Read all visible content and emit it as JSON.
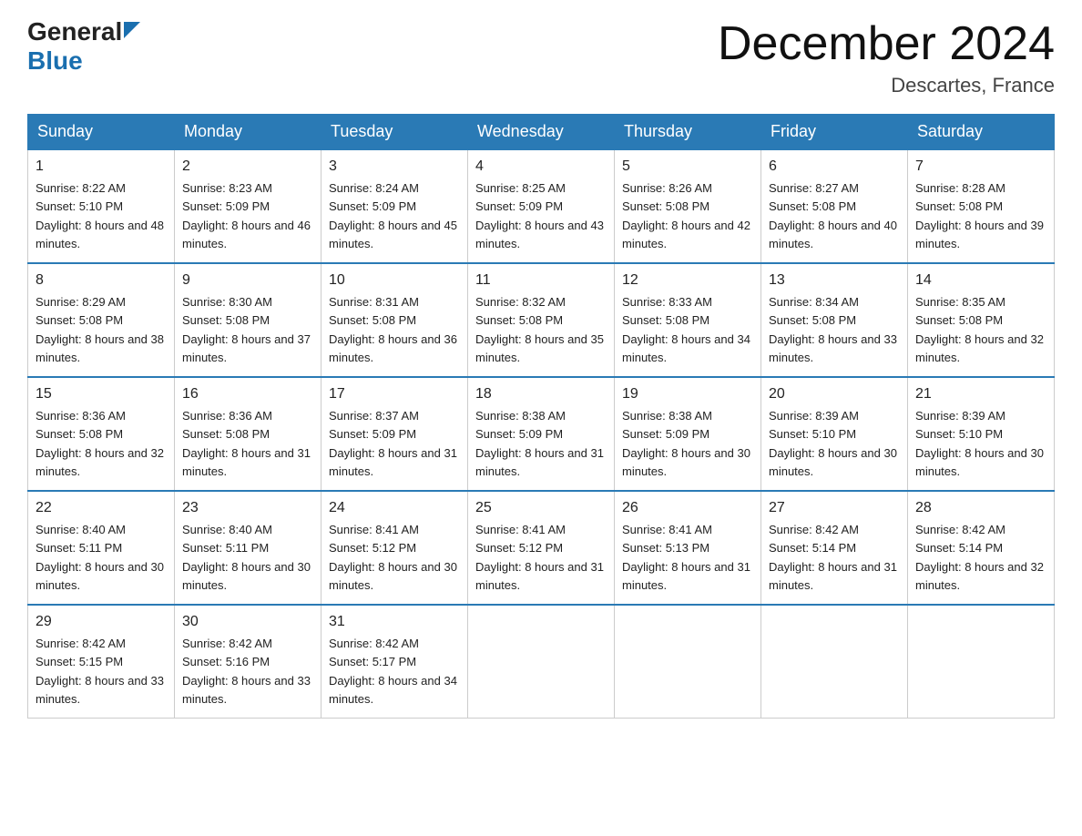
{
  "header": {
    "logo_general": "General",
    "logo_blue": "Blue",
    "title": "December 2024",
    "subtitle": "Descartes, France"
  },
  "days_of_week": [
    "Sunday",
    "Monday",
    "Tuesday",
    "Wednesday",
    "Thursday",
    "Friday",
    "Saturday"
  ],
  "weeks": [
    [
      {
        "day": "1",
        "sunrise": "8:22 AM",
        "sunset": "5:10 PM",
        "daylight": "8 hours and 48 minutes."
      },
      {
        "day": "2",
        "sunrise": "8:23 AM",
        "sunset": "5:09 PM",
        "daylight": "8 hours and 46 minutes."
      },
      {
        "day": "3",
        "sunrise": "8:24 AM",
        "sunset": "5:09 PM",
        "daylight": "8 hours and 45 minutes."
      },
      {
        "day": "4",
        "sunrise": "8:25 AM",
        "sunset": "5:09 PM",
        "daylight": "8 hours and 43 minutes."
      },
      {
        "day": "5",
        "sunrise": "8:26 AM",
        "sunset": "5:08 PM",
        "daylight": "8 hours and 42 minutes."
      },
      {
        "day": "6",
        "sunrise": "8:27 AM",
        "sunset": "5:08 PM",
        "daylight": "8 hours and 40 minutes."
      },
      {
        "day": "7",
        "sunrise": "8:28 AM",
        "sunset": "5:08 PM",
        "daylight": "8 hours and 39 minutes."
      }
    ],
    [
      {
        "day": "8",
        "sunrise": "8:29 AM",
        "sunset": "5:08 PM",
        "daylight": "8 hours and 38 minutes."
      },
      {
        "day": "9",
        "sunrise": "8:30 AM",
        "sunset": "5:08 PM",
        "daylight": "8 hours and 37 minutes."
      },
      {
        "day": "10",
        "sunrise": "8:31 AM",
        "sunset": "5:08 PM",
        "daylight": "8 hours and 36 minutes."
      },
      {
        "day": "11",
        "sunrise": "8:32 AM",
        "sunset": "5:08 PM",
        "daylight": "8 hours and 35 minutes."
      },
      {
        "day": "12",
        "sunrise": "8:33 AM",
        "sunset": "5:08 PM",
        "daylight": "8 hours and 34 minutes."
      },
      {
        "day": "13",
        "sunrise": "8:34 AM",
        "sunset": "5:08 PM",
        "daylight": "8 hours and 33 minutes."
      },
      {
        "day": "14",
        "sunrise": "8:35 AM",
        "sunset": "5:08 PM",
        "daylight": "8 hours and 32 minutes."
      }
    ],
    [
      {
        "day": "15",
        "sunrise": "8:36 AM",
        "sunset": "5:08 PM",
        "daylight": "8 hours and 32 minutes."
      },
      {
        "day": "16",
        "sunrise": "8:36 AM",
        "sunset": "5:08 PM",
        "daylight": "8 hours and 31 minutes."
      },
      {
        "day": "17",
        "sunrise": "8:37 AM",
        "sunset": "5:09 PM",
        "daylight": "8 hours and 31 minutes."
      },
      {
        "day": "18",
        "sunrise": "8:38 AM",
        "sunset": "5:09 PM",
        "daylight": "8 hours and 31 minutes."
      },
      {
        "day": "19",
        "sunrise": "8:38 AM",
        "sunset": "5:09 PM",
        "daylight": "8 hours and 30 minutes."
      },
      {
        "day": "20",
        "sunrise": "8:39 AM",
        "sunset": "5:10 PM",
        "daylight": "8 hours and 30 minutes."
      },
      {
        "day": "21",
        "sunrise": "8:39 AM",
        "sunset": "5:10 PM",
        "daylight": "8 hours and 30 minutes."
      }
    ],
    [
      {
        "day": "22",
        "sunrise": "8:40 AM",
        "sunset": "5:11 PM",
        "daylight": "8 hours and 30 minutes."
      },
      {
        "day": "23",
        "sunrise": "8:40 AM",
        "sunset": "5:11 PM",
        "daylight": "8 hours and 30 minutes."
      },
      {
        "day": "24",
        "sunrise": "8:41 AM",
        "sunset": "5:12 PM",
        "daylight": "8 hours and 30 minutes."
      },
      {
        "day": "25",
        "sunrise": "8:41 AM",
        "sunset": "5:12 PM",
        "daylight": "8 hours and 31 minutes."
      },
      {
        "day": "26",
        "sunrise": "8:41 AM",
        "sunset": "5:13 PM",
        "daylight": "8 hours and 31 minutes."
      },
      {
        "day": "27",
        "sunrise": "8:42 AM",
        "sunset": "5:14 PM",
        "daylight": "8 hours and 31 minutes."
      },
      {
        "day": "28",
        "sunrise": "8:42 AM",
        "sunset": "5:14 PM",
        "daylight": "8 hours and 32 minutes."
      }
    ],
    [
      {
        "day": "29",
        "sunrise": "8:42 AM",
        "sunset": "5:15 PM",
        "daylight": "8 hours and 33 minutes."
      },
      {
        "day": "30",
        "sunrise": "8:42 AM",
        "sunset": "5:16 PM",
        "daylight": "8 hours and 33 minutes."
      },
      {
        "day": "31",
        "sunrise": "8:42 AM",
        "sunset": "5:17 PM",
        "daylight": "8 hours and 34 minutes."
      },
      null,
      null,
      null,
      null
    ]
  ],
  "labels": {
    "sunrise": "Sunrise:",
    "sunset": "Sunset:",
    "daylight": "Daylight:"
  }
}
